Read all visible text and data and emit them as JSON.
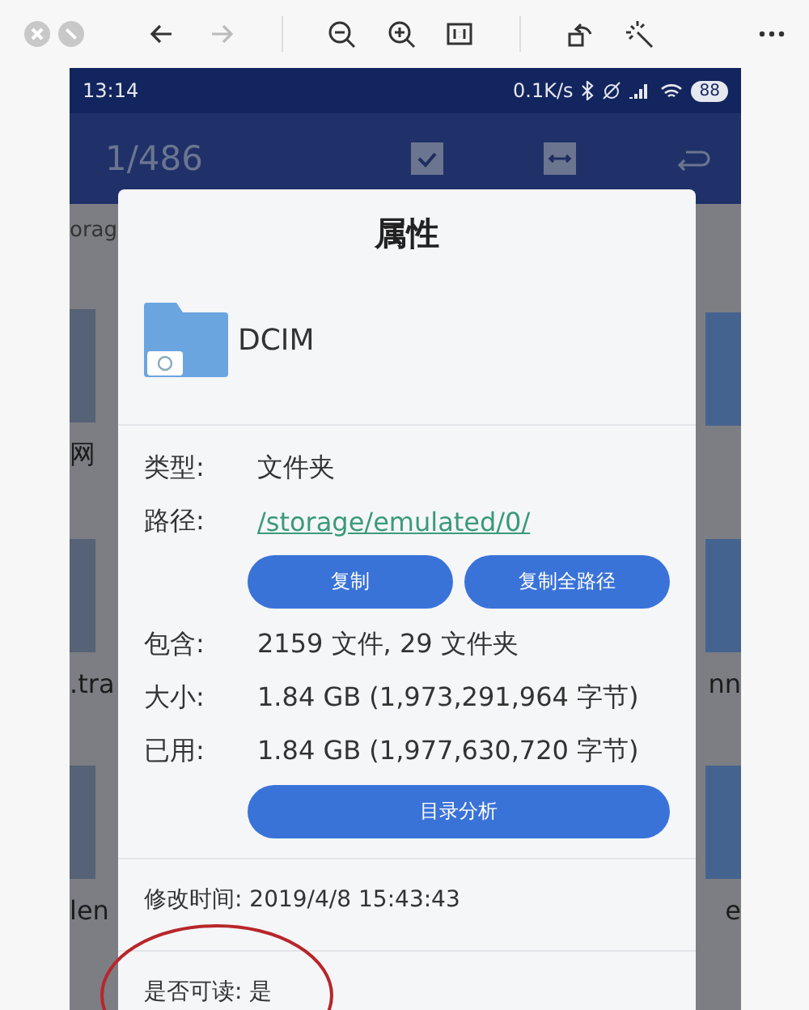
{
  "toolbar": {
    "buttons": [
      {
        "kind": "close",
        "disabled": false
      },
      {
        "kind": "minimize",
        "disabled": false
      },
      {
        "kind": "back",
        "disabled": false
      },
      {
        "kind": "forward",
        "disabled": true
      },
      {
        "kind": "separator"
      },
      {
        "kind": "zoom-out",
        "disabled": false
      },
      {
        "kind": "zoom-in",
        "disabled": false
      },
      {
        "kind": "actual-size",
        "disabled": false
      },
      {
        "kind": "separator"
      },
      {
        "kind": "rotate",
        "disabled": false
      },
      {
        "kind": "enhance",
        "disabled": false
      },
      {
        "kind": "more",
        "disabled": false
      }
    ]
  },
  "phone": {
    "status_bar": {
      "time": "13:14",
      "speed": "0.1K/s",
      "battery": "88"
    },
    "app_bar": {
      "counter": "1/486",
      "actions": [
        {
          "kind": "check"
        },
        {
          "kind": "swap"
        },
        {
          "kind": "return"
        }
      ]
    },
    "breadcrumb": "orag",
    "grid_rows": [
      {
        "left": "网",
        "right": ""
      },
      {
        "left": ".tra",
        "right": "nn"
      },
      {
        "left": "len",
        "right": "e"
      }
    ],
    "dialog": {
      "title": "属性",
      "name": "DCIM",
      "rows": [
        {
          "kind": "pair",
          "label": "类型:",
          "value": "文件夹"
        },
        {
          "kind": "link",
          "label": "路径:",
          "value": "/storage/emulated/0/"
        },
        {
          "kind": "buttons",
          "buttons": [
            "复制",
            "复制全路径"
          ]
        },
        {
          "kind": "pair",
          "label": "包含:",
          "value": "2159 文件, 29 文件夹"
        },
        {
          "kind": "pair",
          "label": "大小:",
          "value": "1.84 GB (1,973,291,964 字节)"
        },
        {
          "kind": "pair",
          "label": "已用:",
          "value": "1.84 GB (1,977,630,720 字节)"
        },
        {
          "kind": "buttons",
          "buttons": [
            "目录分析"
          ]
        },
        {
          "kind": "divider"
        },
        {
          "kind": "line",
          "label": "修改时间:",
          "value": "2019/4/8 15:43:43"
        },
        {
          "kind": "divider"
        },
        {
          "kind": "line",
          "label": "是否可读:",
          "value": "是"
        }
      ]
    }
  }
}
